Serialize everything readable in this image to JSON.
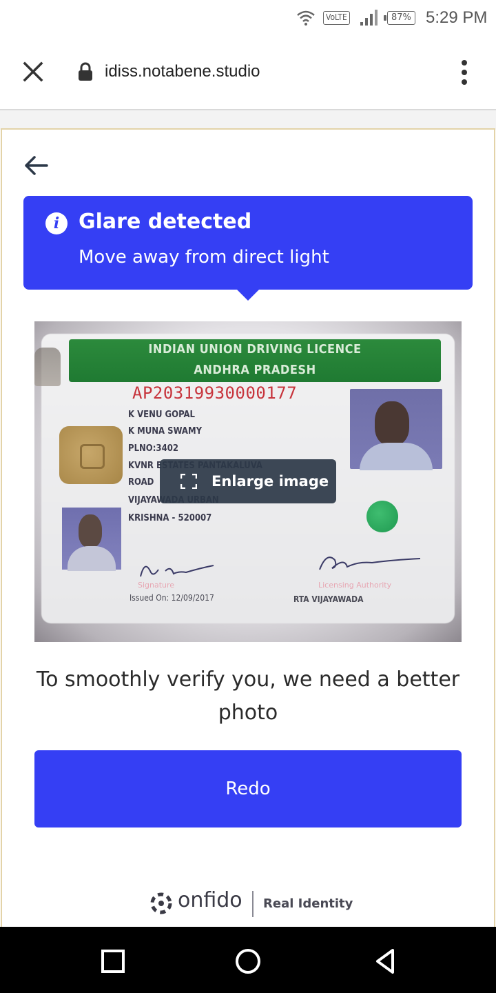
{
  "status_bar": {
    "network_badge": "VoLTE",
    "battery": "87%",
    "time": "5:29 PM",
    "icons": [
      "wifi-icon",
      "signal-icon",
      "battery-icon"
    ]
  },
  "browser": {
    "url": "idiss.notabene.studio",
    "icons": [
      "close-icon",
      "lock-icon",
      "overflow-menu-icon"
    ]
  },
  "alert": {
    "title": "Glare detected",
    "subtitle": "Move away from direct light",
    "icon": "info-icon"
  },
  "document_image": {
    "header_line1": "INDIAN UNION DRIVING LICENCE",
    "header_line2": "ANDHRA PRADESH",
    "licence_number": "AP20319930000177",
    "lines": [
      "K VENU GOPAL",
      "K MUNA SWAMY",
      "PLNO:3402",
      "KVNR ESTATES PANTAKALUVA",
      "ROAD",
      "VIJAYAWADA URBAN",
      "KRISHNA - 520007"
    ],
    "signature_label": "Signature",
    "authority_label": "Licensing Authority",
    "issued_on": "Issued On: 12/09/2017",
    "authority": "RTA VIJAYAWADA"
  },
  "enlarge": {
    "label": "Enlarge image",
    "icon": "expand-icon"
  },
  "message": "To smoothly verify you, we need a better photo",
  "redo_label": "Redo",
  "brand": {
    "name": "onfido",
    "tagline": "Real Identity"
  },
  "nav": {
    "icons": [
      "recents-icon",
      "home-icon",
      "back-icon"
    ]
  },
  "colors": {
    "accent": "#353ff4",
    "enlarge_bg": "#2c3848"
  }
}
